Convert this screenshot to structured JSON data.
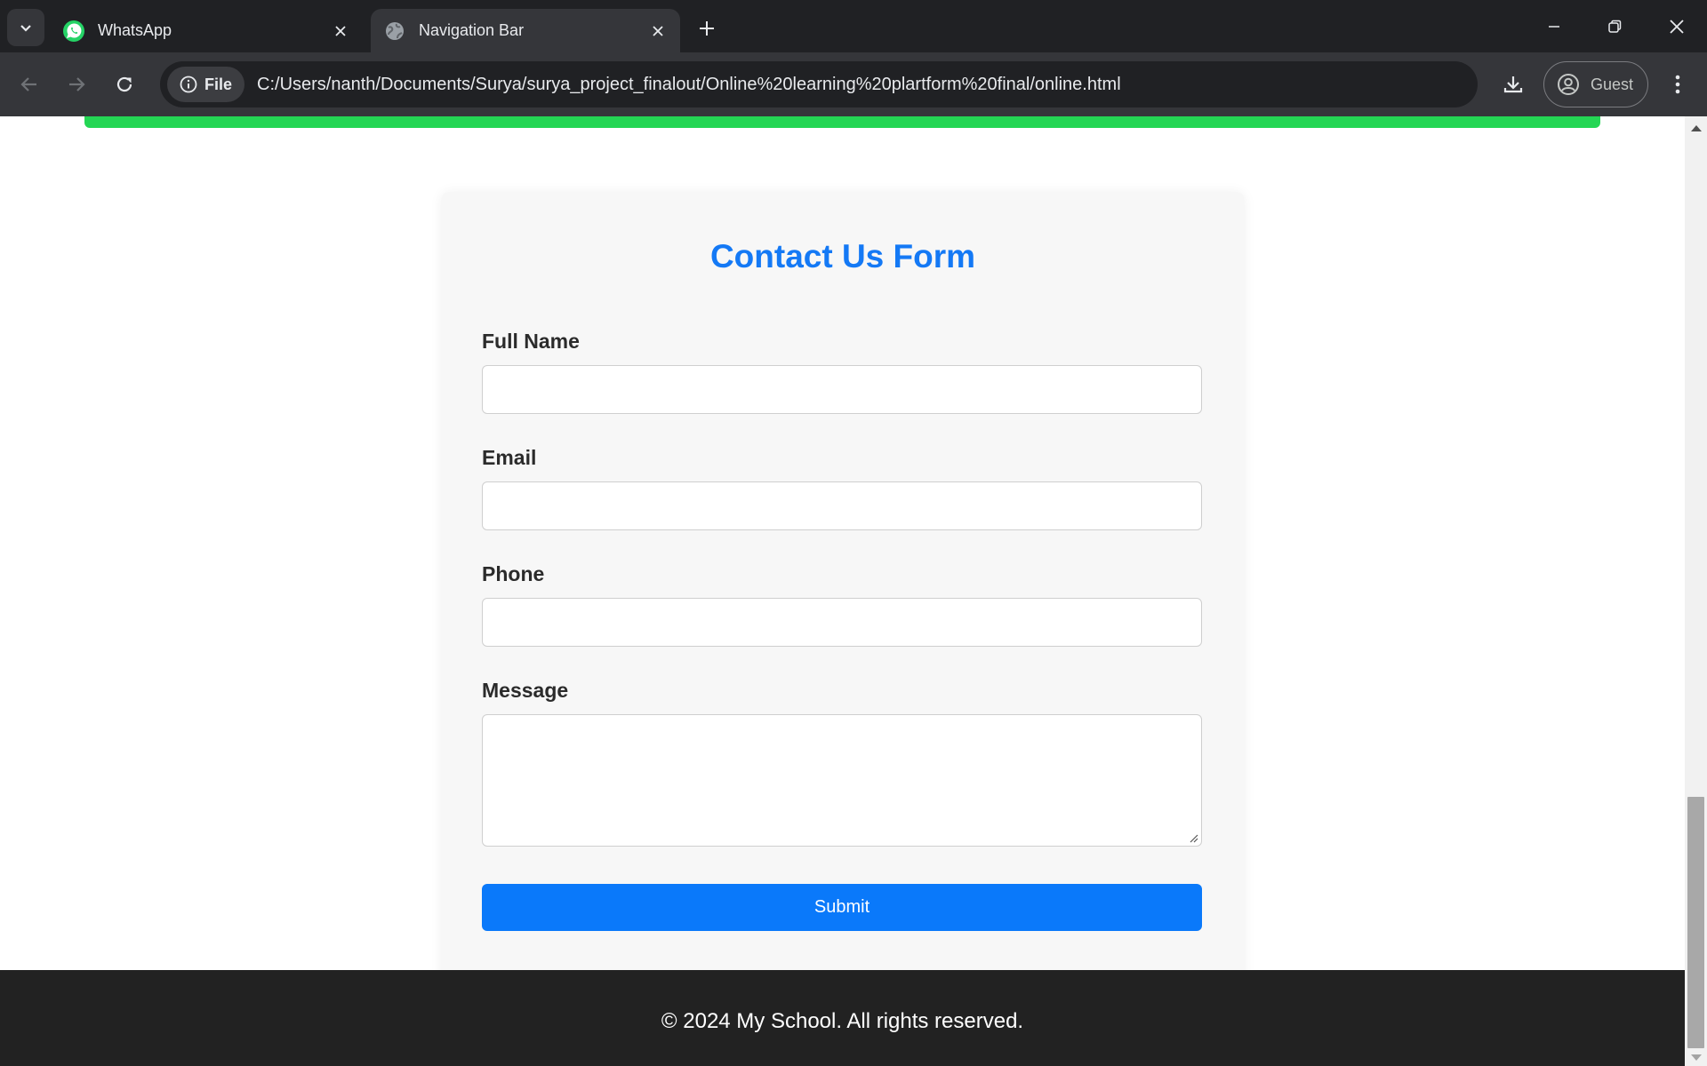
{
  "browser": {
    "tabs": [
      {
        "title": "WhatsApp",
        "icon": "whatsapp-icon",
        "active": false
      },
      {
        "title": "Navigation Bar",
        "icon": "globe-icon",
        "active": true
      }
    ],
    "site_chip_label": "File",
    "url": "C:/Users/nanth/Documents/Surya/surya_project_finalout/Online%20learning%20plartform%20final/online.html",
    "profile_label": "Guest"
  },
  "form": {
    "title": "Contact Us Form",
    "fields": {
      "full_name_label": "Full Name",
      "email_label": "Email",
      "phone_label": "Phone",
      "message_label": "Message"
    },
    "submit_label": "Submit"
  },
  "footer": {
    "text": "© 2024 My School. All rights reserved."
  },
  "colors": {
    "accent": "#0a79fa",
    "title": "#1479f5",
    "top_bar": "#24d654",
    "footer_bg": "#222222"
  }
}
